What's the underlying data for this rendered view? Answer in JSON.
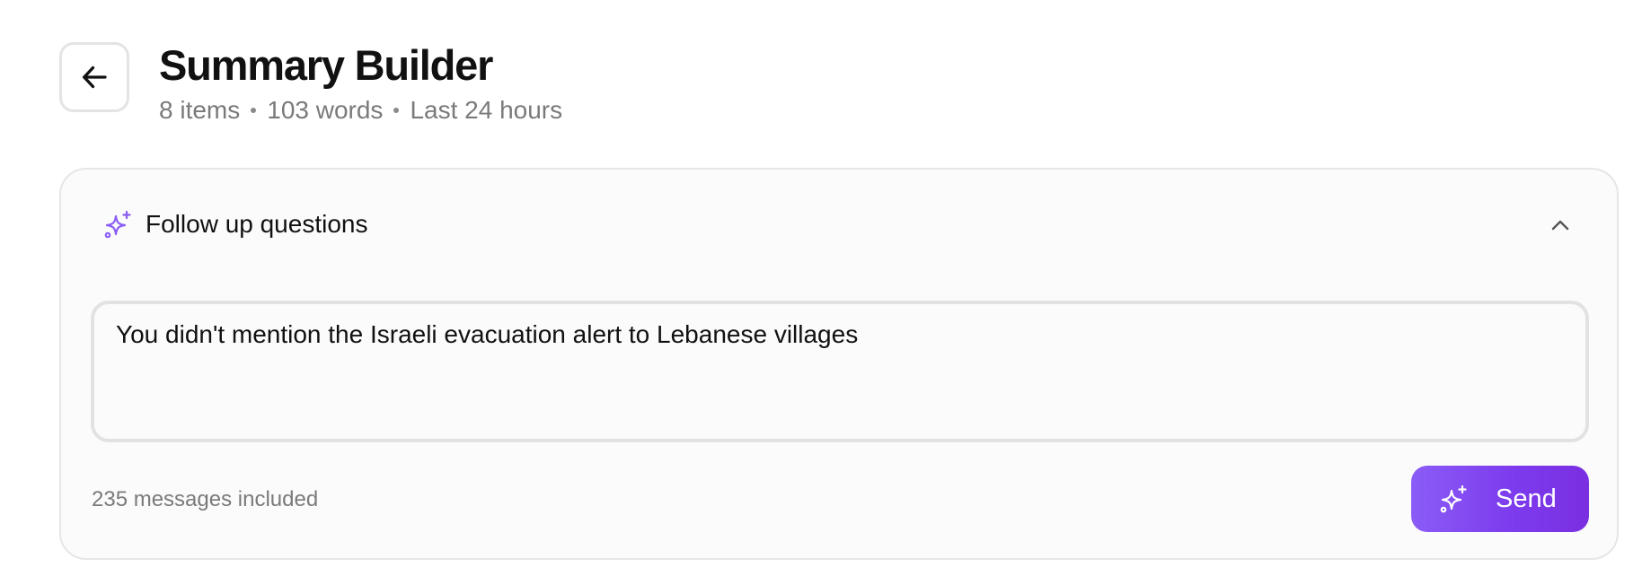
{
  "header": {
    "title": "Summary Builder",
    "meta": {
      "items": "8 items",
      "words": "103 words",
      "range": "Last 24 hours"
    }
  },
  "followup": {
    "title": "Follow up questions",
    "input_value": "You didn't mention the Israeli evacuation alert to Lebanese villages",
    "messages_included": "235 messages included",
    "send_label": "Send"
  },
  "icons": {
    "back": "arrow-left-icon",
    "sparkle": "sparkle-icon",
    "collapse": "chevron-up-icon"
  },
  "colors": {
    "accent": "#8b5cf6",
    "accent_dark": "#7c3aed",
    "muted_text": "#7a7a7a",
    "border": "#e4e4e4"
  }
}
